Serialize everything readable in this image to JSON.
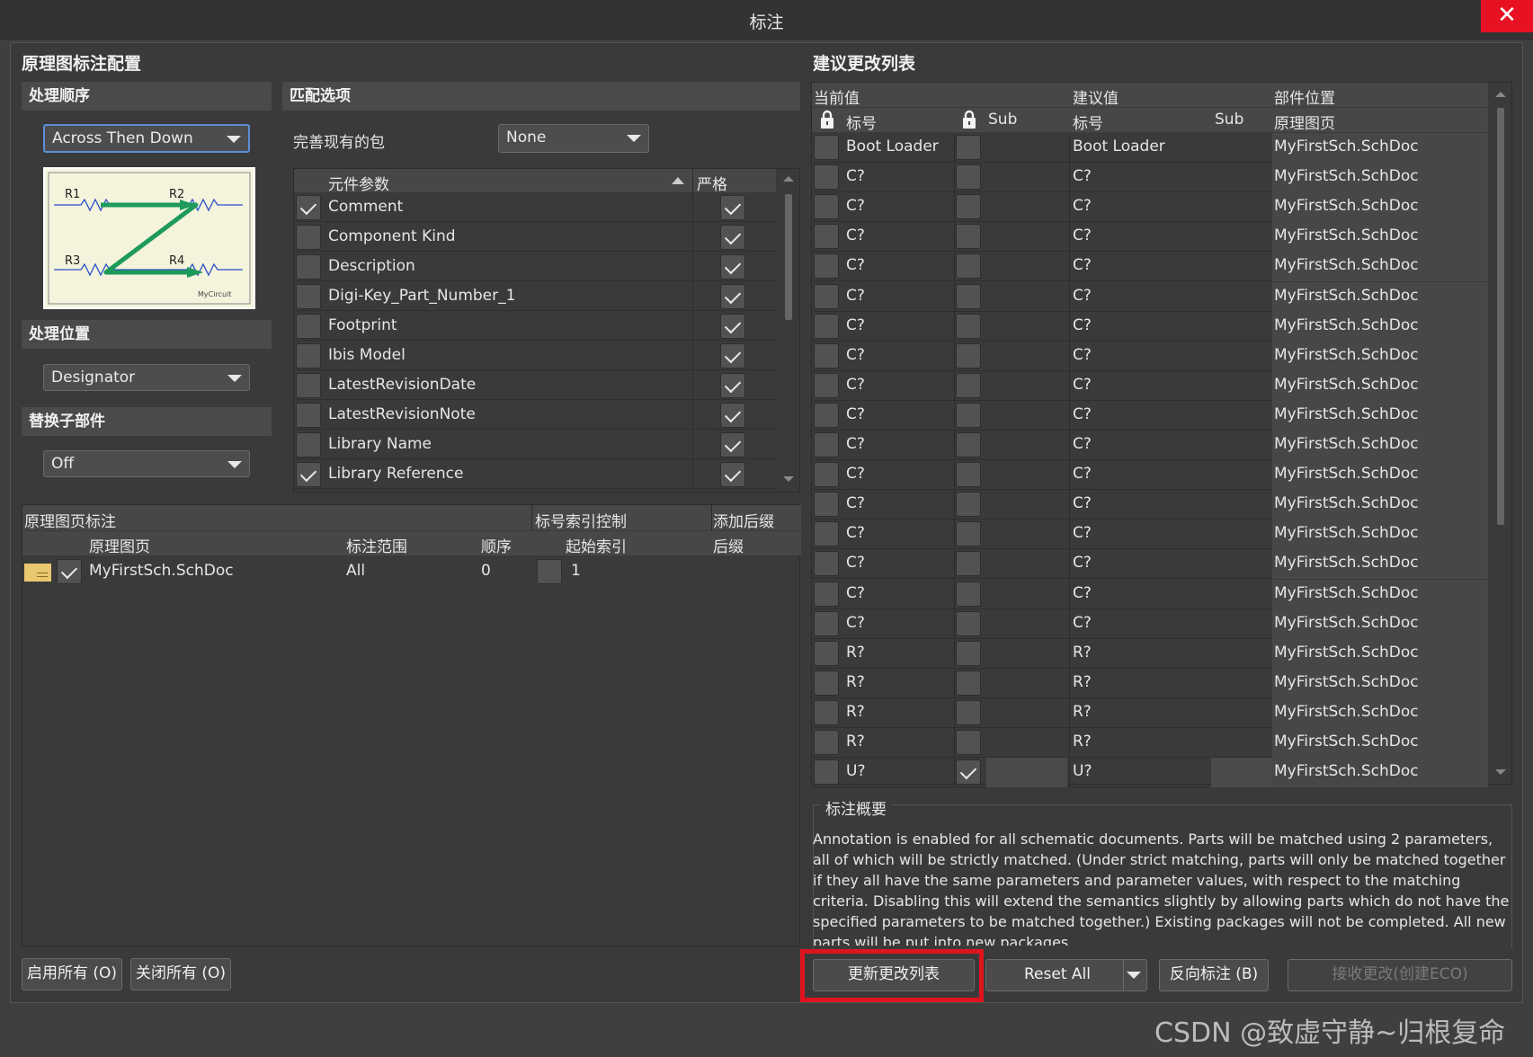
{
  "window": {
    "title": "标注",
    "close_glyph": "✕"
  },
  "left": {
    "title": "原理图标注配置",
    "order": {
      "header": "处理顺序",
      "value": "Across Then Down",
      "diagram_labels": [
        "R1",
        "R2",
        "R3",
        "R4"
      ],
      "diagram_caption": "MyCircuit"
    },
    "location": {
      "header": "处理位置",
      "value": "Designator"
    },
    "replace": {
      "header": "替换子部件",
      "value": "Off"
    }
  },
  "match": {
    "header": "匹配选项",
    "complete_label": "完善现有的包",
    "complete_value": "None",
    "col_param": "元件参数",
    "col_strict": "严格",
    "rows": [
      {
        "name": "Comment",
        "checked": true,
        "strict": true
      },
      {
        "name": "Component Kind",
        "checked": false,
        "strict": true
      },
      {
        "name": "Description",
        "checked": false,
        "strict": true
      },
      {
        "name": "Digi-Key_Part_Number_1",
        "checked": false,
        "strict": true
      },
      {
        "name": "Footprint",
        "checked": false,
        "strict": true
      },
      {
        "name": "Ibis Model",
        "checked": false,
        "strict": true
      },
      {
        "name": "LatestRevisionDate",
        "checked": false,
        "strict": true
      },
      {
        "name": "LatestRevisionNote",
        "checked": false,
        "strict": true
      },
      {
        "name": "Library Name",
        "checked": false,
        "strict": true
      },
      {
        "name": "Library Reference",
        "checked": true,
        "strict": true
      }
    ]
  },
  "sheets": {
    "group1": "原理图页标注",
    "group2": "标号索引控制",
    "group3": "添加后缀",
    "col_sheet": "原理图页",
    "col_scope": "标注范围",
    "col_order": "顺序",
    "col_start": "起始索引",
    "col_suffix": "后缀",
    "rows": [
      {
        "sheet": "MyFirstSch.SchDoc",
        "scope": "All",
        "order": "0",
        "start": "1",
        "suffix": ""
      }
    ]
  },
  "changes": {
    "title": "建议更改列表",
    "grp_current": "当前值",
    "grp_proposed": "建议值",
    "grp_location": "部件位置",
    "col_designator": "标号",
    "col_sub": "Sub",
    "col_designator2": "标号",
    "col_sub2": "Sub",
    "col_sheet": "原理图页",
    "rows": [
      {
        "cur": "Boot Loader",
        "prop": "Boot Loader",
        "sheet": "MyFirstSch.SchDoc",
        "sub_checked": false
      },
      {
        "cur": "C?",
        "prop": "C?",
        "sheet": "MyFirstSch.SchDoc",
        "sub_checked": false
      },
      {
        "cur": "C?",
        "prop": "C?",
        "sheet": "MyFirstSch.SchDoc",
        "sub_checked": false
      },
      {
        "cur": "C?",
        "prop": "C?",
        "sheet": "MyFirstSch.SchDoc",
        "sub_checked": false
      },
      {
        "cur": "C?",
        "prop": "C?",
        "sheet": "MyFirstSch.SchDoc",
        "sub_checked": false
      },
      {
        "cur": "C?",
        "prop": "C?",
        "sheet": "MyFirstSch.SchDoc",
        "sub_checked": false
      },
      {
        "cur": "C?",
        "prop": "C?",
        "sheet": "MyFirstSch.SchDoc",
        "sub_checked": false
      },
      {
        "cur": "C?",
        "prop": "C?",
        "sheet": "MyFirstSch.SchDoc",
        "sub_checked": false
      },
      {
        "cur": "C?",
        "prop": "C?",
        "sheet": "MyFirstSch.SchDoc",
        "sub_checked": false
      },
      {
        "cur": "C?",
        "prop": "C?",
        "sheet": "MyFirstSch.SchDoc",
        "sub_checked": false
      },
      {
        "cur": "C?",
        "prop": "C?",
        "sheet": "MyFirstSch.SchDoc",
        "sub_checked": false
      },
      {
        "cur": "C?",
        "prop": "C?",
        "sheet": "MyFirstSch.SchDoc",
        "sub_checked": false
      },
      {
        "cur": "C?",
        "prop": "C?",
        "sheet": "MyFirstSch.SchDoc",
        "sub_checked": false
      },
      {
        "cur": "C?",
        "prop": "C?",
        "sheet": "MyFirstSch.SchDoc",
        "sub_checked": false
      },
      {
        "cur": "C?",
        "prop": "C?",
        "sheet": "MyFirstSch.SchDoc",
        "sub_checked": false
      },
      {
        "cur": "C?",
        "prop": "C?",
        "sheet": "MyFirstSch.SchDoc",
        "sub_checked": false
      },
      {
        "cur": "C?",
        "prop": "C?",
        "sheet": "MyFirstSch.SchDoc",
        "sub_checked": false
      },
      {
        "cur": "R?",
        "prop": "R?",
        "sheet": "MyFirstSch.SchDoc",
        "sub_checked": false
      },
      {
        "cur": "R?",
        "prop": "R?",
        "sheet": "MyFirstSch.SchDoc",
        "sub_checked": false
      },
      {
        "cur": "R?",
        "prop": "R?",
        "sheet": "MyFirstSch.SchDoc",
        "sub_checked": false
      },
      {
        "cur": "R?",
        "prop": "R?",
        "sheet": "MyFirstSch.SchDoc",
        "sub_checked": false
      },
      {
        "cur": "U?",
        "prop": "U?",
        "sheet": "MyFirstSch.SchDoc",
        "sub_checked": true
      }
    ]
  },
  "summary": {
    "header": "标注概要",
    "text": "Annotation is enabled for all schematic documents. Parts will be matched using 2 parameters, all of which will be strictly matched. (Under strict matching, parts will only be matched together if they all have the same parameters and parameter values, with respect to the matching criteria. Disabling this will extend the semantics slightly by allowing parts which do not have the specified parameters to be matched together.) Existing packages will not be completed. All new parts will be put into new packages."
  },
  "buttons": {
    "enable_all": "启用所有 (O)",
    "disable_all": "关闭所有 (O)",
    "update_list": "更新更改列表",
    "reset_all": "Reset All",
    "back_annotate": "反向标注 (B)",
    "accept": "接收更改(创建ECO)"
  },
  "watermark": "CSDN @致虚守静~归根复命",
  "colors": {
    "highlight_box": "#e0141e",
    "close_red": "#e81123",
    "diagram_arrow": "#1e9a5a",
    "sheet_icon": "#e8c770"
  }
}
